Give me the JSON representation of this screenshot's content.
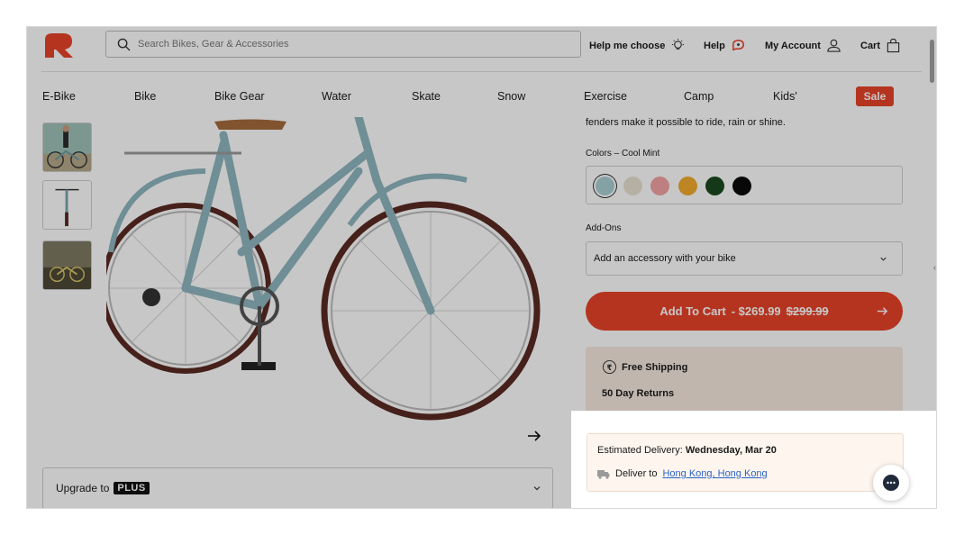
{
  "brand": {
    "logo_icon": "retrospec-logo-icon",
    "accent": "#e8432a"
  },
  "header": {
    "search_placeholder": "Search Bikes, Gear & Accessories",
    "help_me_choose": "Help me choose",
    "help": "Help",
    "my_account": "My Account",
    "cart": "Cart"
  },
  "nav": {
    "items": [
      "E-Bike",
      "Bike",
      "Bike Gear",
      "Water",
      "Skate",
      "Snow",
      "Exercise",
      "Camp",
      "Kids'"
    ],
    "sale": "Sale"
  },
  "product": {
    "description_snippet": "fenders make it possible to ride, rain or shine.",
    "colors_label": "Colors – Cool Mint",
    "colors": [
      {
        "name": "Cool Mint",
        "hex": "#a9d0d3",
        "selected": true
      },
      {
        "name": "Sand",
        "hex": "#eae1d3",
        "selected": false
      },
      {
        "name": "Pink",
        "hex": "#f2a3a3",
        "selected": false
      },
      {
        "name": "Mustard",
        "hex": "#f2ab2e",
        "selected": false
      },
      {
        "name": "Forest",
        "hex": "#1c4a1f",
        "selected": false
      },
      {
        "name": "Black",
        "hex": "#0b0b0b",
        "selected": false
      }
    ],
    "addons_label": "Add-Ons",
    "addons_select": "Add an accessory with your bike",
    "add_to_cart": "Add To Cart",
    "price": "- $269.99",
    "old_price": "$299.99",
    "free_shipping": "Free Shipping",
    "returns": "50 Day Returns",
    "upgrade_label": "Upgrade to",
    "plus_badge": "PLUS"
  },
  "delivery": {
    "estimate_label": "Estimated Delivery:",
    "estimate_date": "Wednesday, Mar 20",
    "deliver_to_label": "Deliver to",
    "location": "Hong Kong, Hong Kong"
  },
  "bike_frame_color": "#8fb7bf",
  "tire_color": "#5a2a22"
}
